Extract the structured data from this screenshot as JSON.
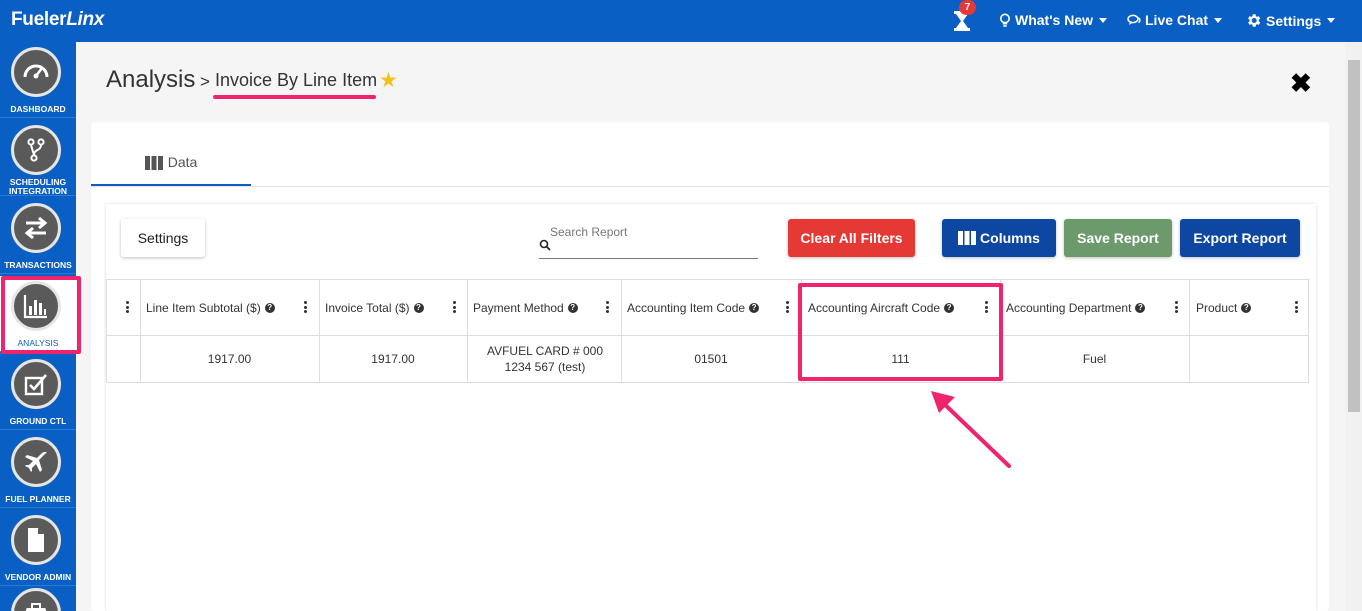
{
  "brand": {
    "name_part1": "Fueler",
    "name_part2": "Linx"
  },
  "topnav": {
    "notification_count": "7",
    "whats_new": "What's New",
    "live_chat": "Live Chat",
    "settings": "Settings"
  },
  "sidebar": {
    "items": [
      {
        "label": "DASHBOARD",
        "icon": "speedometer-icon"
      },
      {
        "label": "SCHEDULING INTEGRATION",
        "icon": "branch-icon"
      },
      {
        "label": "TRANSACTIONS",
        "icon": "swap-arrows-icon"
      },
      {
        "label": "ANALYSIS",
        "icon": "bar-chart-icon",
        "active": true
      },
      {
        "label": "GROUND CTL",
        "icon": "checkbox-pen-icon"
      },
      {
        "label": "FUEL PLANNER",
        "icon": "airplane-icon"
      },
      {
        "label": "VENDOR ADMIN",
        "icon": "document-icon"
      }
    ]
  },
  "header": {
    "breadcrumb_root": "Analysis",
    "breadcrumb_sep": ">",
    "page_title": "Invoice By Line Item"
  },
  "tabs": [
    {
      "label": "Data",
      "active": true
    }
  ],
  "toolbar": {
    "settings": "Settings",
    "search_placeholder": "Search Report",
    "clear_filters": "Clear All Filters",
    "columns": "Columns",
    "save_report": "Save Report",
    "export_report": "Export Report"
  },
  "table": {
    "columns": [
      "Line Item Subtotal ($)",
      "Invoice Total ($)",
      "Payment Method",
      "Accounting Item Code",
      "Accounting Aircraft Code",
      "Accounting Department",
      "Product"
    ],
    "rows": [
      {
        "line_item_subtotal": "1917.00",
        "invoice_total": "1917.00",
        "payment_method": "AVFUEL CARD # 000 1234 567 (test)",
        "accounting_item_code": "01501",
        "accounting_aircraft_code": "111",
        "accounting_department": "Fuel",
        "product": ""
      }
    ]
  },
  "colors": {
    "primary": "#0a5fc4",
    "highlight": "#f0246e",
    "danger": "#e53935",
    "success": "#6c9a6c",
    "navy": "#0d47a1",
    "star": "#f2c21b"
  }
}
